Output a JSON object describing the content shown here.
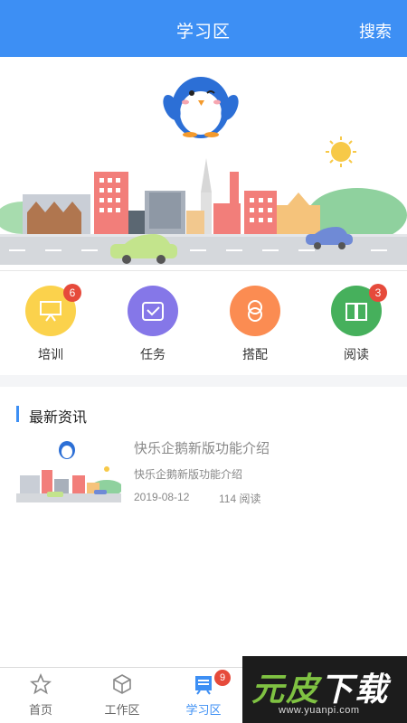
{
  "header": {
    "title": "学习区",
    "search_label": "搜索"
  },
  "categories": [
    {
      "label": "培训",
      "badge": "6",
      "color": "#fbd24c",
      "icon": "presentation-icon"
    },
    {
      "label": "任务",
      "badge": "",
      "color": "#8577e8",
      "icon": "checkmark-tray-icon"
    },
    {
      "label": "搭配",
      "badge": "",
      "color": "#fb8c52",
      "icon": "interlock-icon"
    },
    {
      "label": "阅读",
      "badge": "3",
      "color": "#46b05c",
      "icon": "book-icon"
    }
  ],
  "news": {
    "heading": "最新资讯",
    "items": [
      {
        "title": "快乐企鹅新版功能介绍",
        "summary": "快乐企鹅新版功能介绍",
        "date": "2019-08-12",
        "reads": "114 阅读"
      }
    ]
  },
  "tabbar": {
    "tabs": [
      {
        "label": "首页",
        "icon": "home-star-icon",
        "active": false
      },
      {
        "label": "工作区",
        "icon": "cube-icon",
        "active": false
      },
      {
        "label": "学习区",
        "icon": "study-list-icon",
        "active": true,
        "badge": "9"
      }
    ]
  },
  "watermark": {
    "text_green": "元皮",
    "text_white": "下载",
    "url": "www.yuanpi.com"
  },
  "colors": {
    "primary": "#3d8ff4",
    "badge": "#e64a3b"
  }
}
